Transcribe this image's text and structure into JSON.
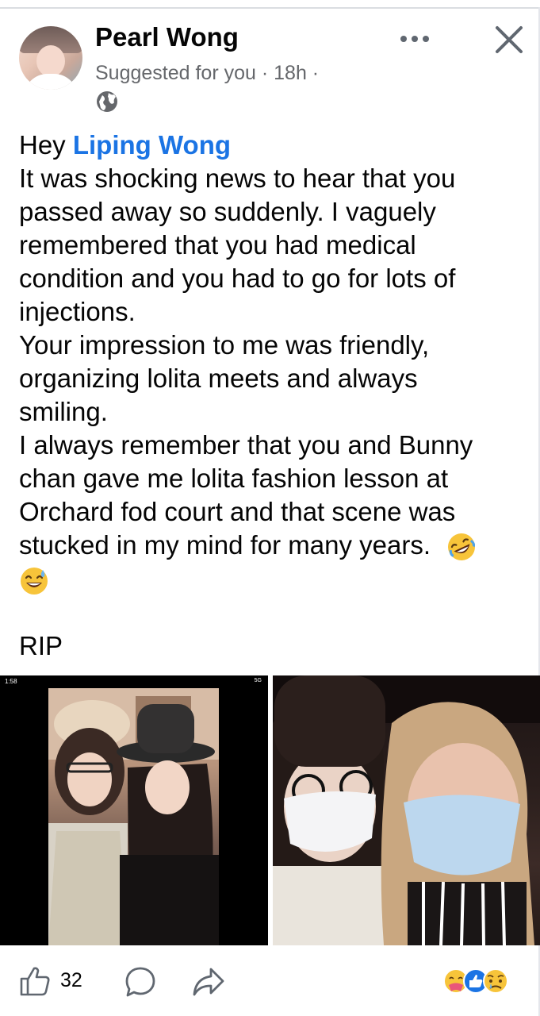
{
  "post": {
    "author": "Pearl Wong",
    "meta": "Suggested for you · 18h ·",
    "audience_icon": "globe-icon",
    "greeting": "Hey ",
    "mention": "Liping Wong",
    "lines": [
      "It was shocking news to hear that you",
      "passed away so suddenly. I vaguely",
      "remembered that you had medical",
      "condition and you had to go for lots of",
      "injections.",
      "Your impression to me was friendly,",
      "organizing lolita meets and always",
      "smiling.",
      "I always remember that you and Bunny",
      "chan gave me lolita fashion lesson at",
      "Orchard fod court and that scene was",
      "stucked in my mind for many years."
    ],
    "rip": "RIP"
  },
  "photo_left": {
    "status_time": "1:58",
    "status_right": "5G"
  },
  "actions": {
    "like_count": "32"
  },
  "icons": {
    "more": "more-options-icon",
    "close": "close-icon",
    "like": "thumbs-up-icon",
    "comment": "comment-icon",
    "share": "share-icon"
  },
  "colors": {
    "mention": "#1b74e4",
    "meta": "#65676b",
    "text": "#050505"
  }
}
